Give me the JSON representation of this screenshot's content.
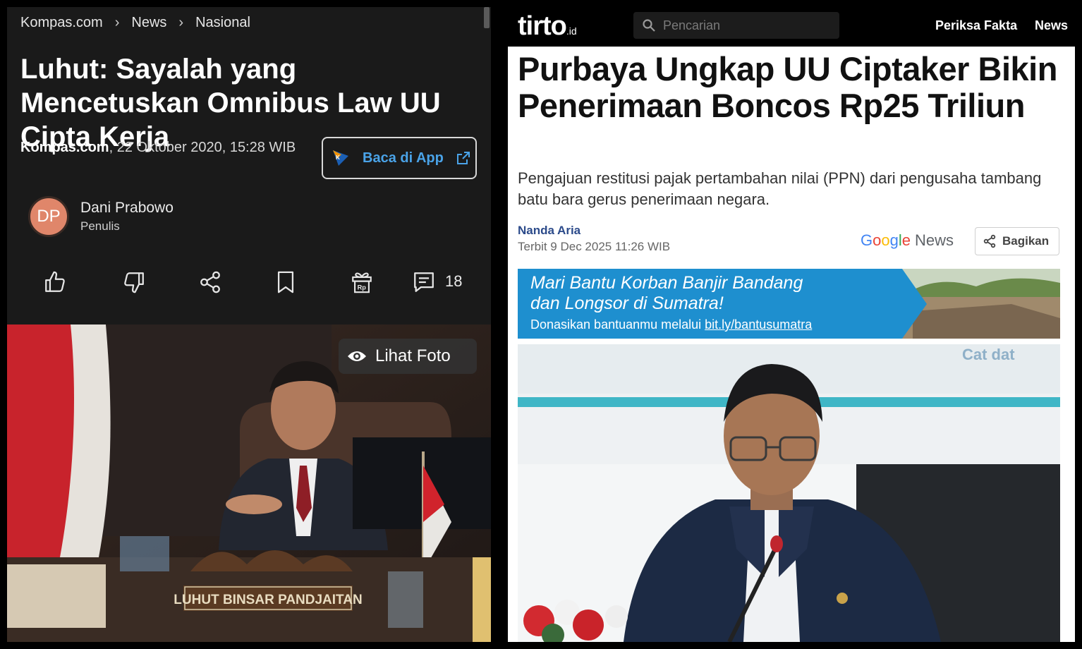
{
  "kompas": {
    "breadcrumb": [
      "Kompas.com",
      "News",
      "Nasional"
    ],
    "breadcrumb_sep": "›",
    "title": "Luhut: Sayalah yang Mencetuskan Omnibus Law UU Cipta Kerja",
    "source": "Kompas.com",
    "date": ", 22 Oktober 2020, 15:28 WIB",
    "app_button": "Baca di App",
    "author_initials": "DP",
    "author_name": "Dani Prabowo",
    "author_role": "Penulis",
    "comment_count": "18",
    "photo_button": "Lihat Foto",
    "nameplate": "LUHUT BINSAR PANDJAITAN",
    "action_icons": [
      "thumbs-up-icon",
      "thumbs-down-icon",
      "share-icon",
      "bookmark-icon",
      "gift-rp-icon",
      "comment-icon"
    ],
    "colors": {
      "background": "#1a1a1a",
      "accent": "#4aa3e8",
      "avatar": "#e0866a"
    }
  },
  "tirto": {
    "logo": "tirto",
    "logo_suffix": ".id",
    "search_placeholder": "Pencarian",
    "nav": [
      "Periksa Fakta",
      "News"
    ],
    "title": "Purbaya Ungkap UU Ciptaker Bikin Penerimaan Boncos Rp25 Triliun",
    "lead": "Pengajuan restitusi pajak pertambahan nilai (PPN) dari pengusaha tambang batu bara gerus penerimaan negara.",
    "author": "Nanda Aria",
    "published": "Terbit 9 Dec 2025 11:26 WIB",
    "google_news": "News",
    "share_button": "Bagikan",
    "banner": {
      "line1": "Mari Bantu Korban Banjir Bandang",
      "line2": "dan Longsor di Sumatra!",
      "line3_prefix": "Donasikan bantuanmu melalui ",
      "line3_link": "bit.ly/bantusumatra"
    },
    "colors": {
      "nav_bg": "#000000",
      "author_link": "#2b4a8a",
      "banner_blue": "#1e8fcf"
    }
  }
}
